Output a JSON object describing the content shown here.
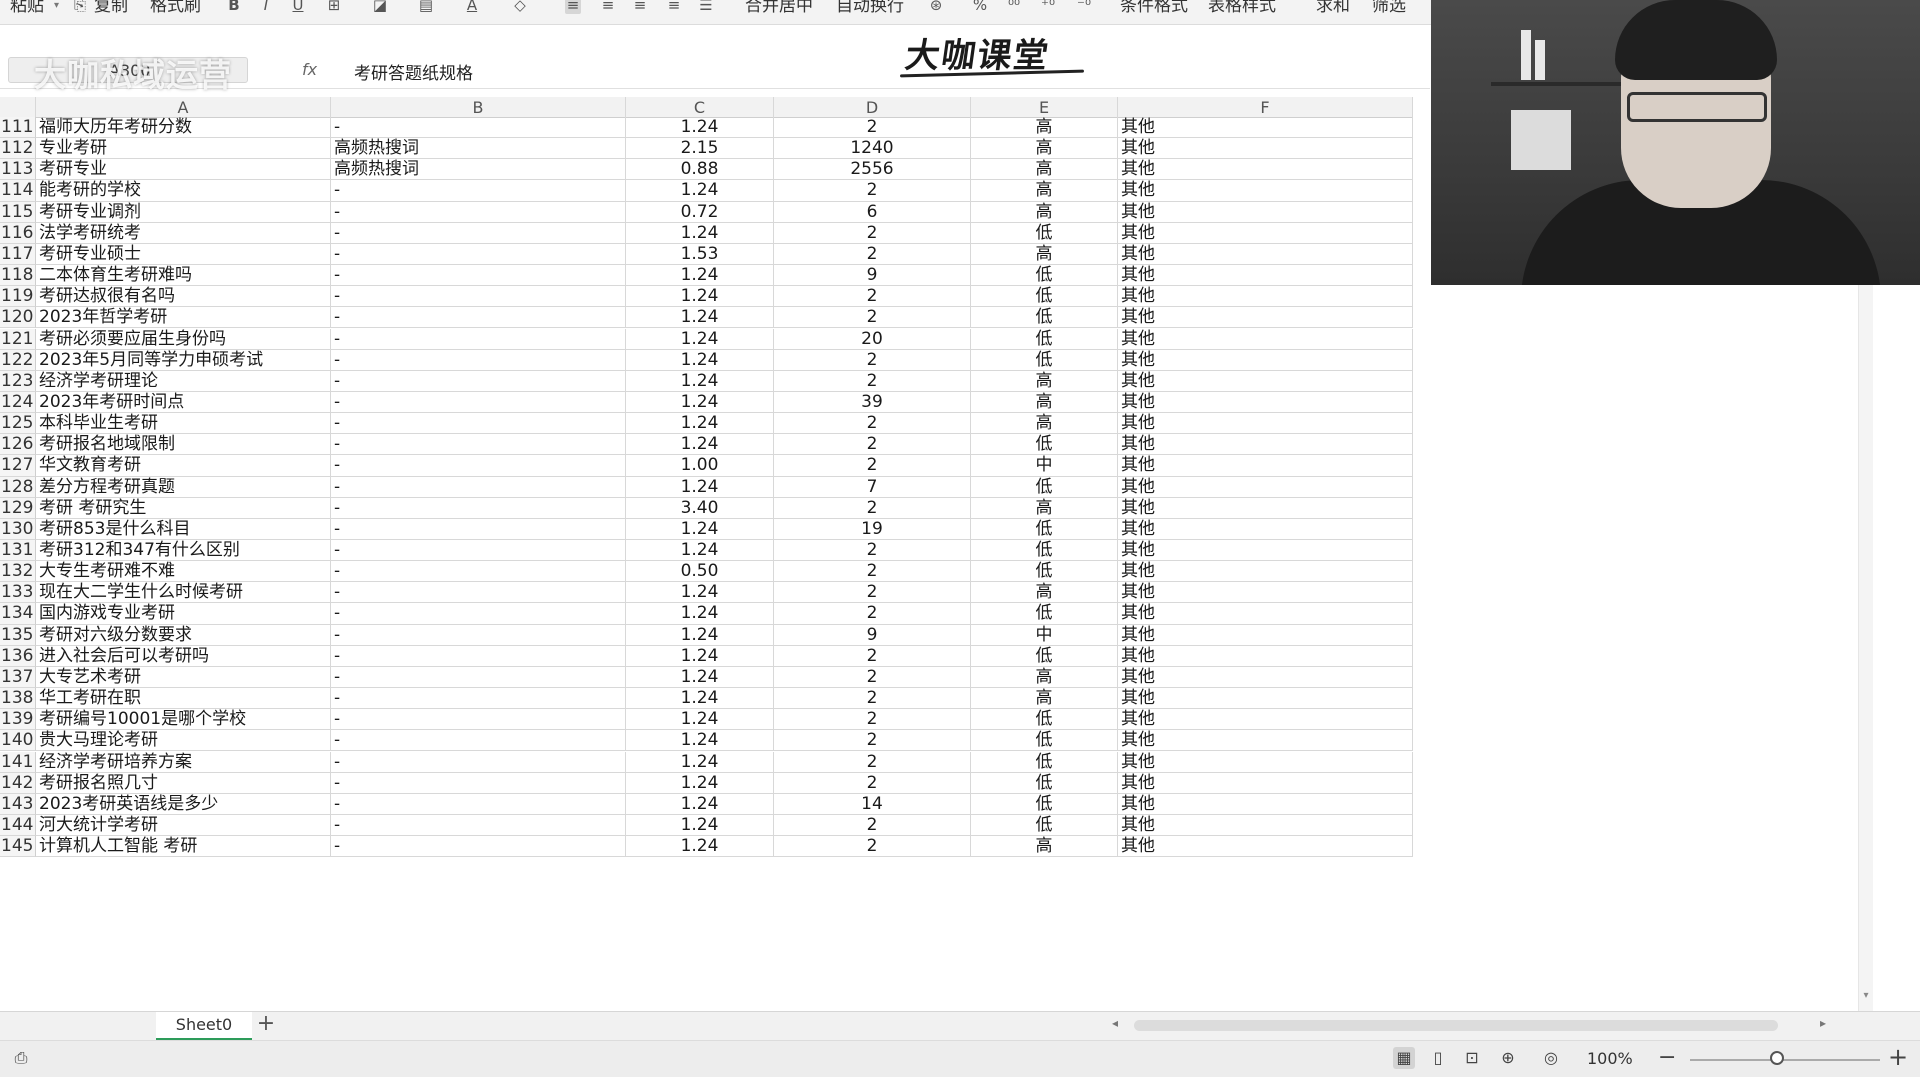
{
  "ribbon": {
    "paste": "粘贴",
    "copy": "复制",
    "format_painter": "格式刷",
    "merge_center": "合并居中",
    "wrap_text": "自动换行",
    "conditional_format": "条件格式",
    "table_style": "表格样式",
    "sum": "求和",
    "filter": "筛选",
    "bold": "B",
    "italic": "I",
    "underline": "U",
    "font_color": "A",
    "percent": "%"
  },
  "formula_bar": {
    "name_box": "A300",
    "fx": "fx",
    "value": "考研答题纸规格"
  },
  "watermark": "大咖私域运营",
  "brand_logo": "大咖课堂",
  "columns": [
    "A",
    "B",
    "C",
    "D",
    "E",
    "F"
  ],
  "rows": [
    {
      "n": "111",
      "a": "福师大历年考研分数",
      "b": "-",
      "c": "1.24",
      "d": "2",
      "e": "高",
      "f": "其他"
    },
    {
      "n": "112",
      "a": "专业考研",
      "b": "高频热搜词",
      "c": "2.15",
      "d": "1240",
      "e": "高",
      "f": "其他"
    },
    {
      "n": "113",
      "a": "考研专业",
      "b": "高频热搜词",
      "c": "0.88",
      "d": "2556",
      "e": "高",
      "f": "其他"
    },
    {
      "n": "114",
      "a": "能考研的学校",
      "b": "-",
      "c": "1.24",
      "d": "2",
      "e": "高",
      "f": "其他"
    },
    {
      "n": "115",
      "a": "考研专业调剂",
      "b": "-",
      "c": "0.72",
      "d": "6",
      "e": "高",
      "f": "其他"
    },
    {
      "n": "116",
      "a": "法学考研统考",
      "b": "-",
      "c": "1.24",
      "d": "2",
      "e": "低",
      "f": "其他"
    },
    {
      "n": "117",
      "a": "考研专业硕士",
      "b": "-",
      "c": "1.53",
      "d": "2",
      "e": "高",
      "f": "其他"
    },
    {
      "n": "118",
      "a": "二本体育生考研难吗",
      "b": "-",
      "c": "1.24",
      "d": "9",
      "e": "低",
      "f": "其他"
    },
    {
      "n": "119",
      "a": "考研达叔很有名吗",
      "b": "-",
      "c": "1.24",
      "d": "2",
      "e": "低",
      "f": "其他"
    },
    {
      "n": "120",
      "a": "2023年哲学考研",
      "b": "-",
      "c": "1.24",
      "d": "2",
      "e": "低",
      "f": "其他"
    },
    {
      "n": "121",
      "a": "考研必须要应届生身份吗",
      "b": "-",
      "c": "1.24",
      "d": "20",
      "e": "低",
      "f": "其他"
    },
    {
      "n": "122",
      "a": "2023年5月同等学力申硕考试",
      "b": "-",
      "c": "1.24",
      "d": "2",
      "e": "低",
      "f": "其他"
    },
    {
      "n": "123",
      "a": "经济学考研理论",
      "b": "-",
      "c": "1.24",
      "d": "2",
      "e": "高",
      "f": "其他"
    },
    {
      "n": "124",
      "a": "2023年考研时间点",
      "b": "-",
      "c": "1.24",
      "d": "39",
      "e": "高",
      "f": "其他"
    },
    {
      "n": "125",
      "a": "本科毕业生考研",
      "b": "-",
      "c": "1.24",
      "d": "2",
      "e": "高",
      "f": "其他"
    },
    {
      "n": "126",
      "a": "考研报名地域限制",
      "b": "-",
      "c": "1.24",
      "d": "2",
      "e": "低",
      "f": "其他"
    },
    {
      "n": "127",
      "a": "华文教育考研",
      "b": "-",
      "c": "1.00",
      "d": "2",
      "e": "中",
      "f": "其他"
    },
    {
      "n": "128",
      "a": "差分方程考研真题",
      "b": "-",
      "c": "1.24",
      "d": "7",
      "e": "低",
      "f": "其他"
    },
    {
      "n": "129",
      "a": "考研 考研究生",
      "b": "-",
      "c": "3.40",
      "d": "2",
      "e": "高",
      "f": "其他"
    },
    {
      "n": "130",
      "a": "考研853是什么科目",
      "b": "-",
      "c": "1.24",
      "d": "19",
      "e": "低",
      "f": "其他"
    },
    {
      "n": "131",
      "a": "考研312和347有什么区别",
      "b": "-",
      "c": "1.24",
      "d": "2",
      "e": "低",
      "f": "其他"
    },
    {
      "n": "132",
      "a": "大专生考研难不难",
      "b": "-",
      "c": "0.50",
      "d": "2",
      "e": "低",
      "f": "其他"
    },
    {
      "n": "133",
      "a": "现在大二学生什么时候考研",
      "b": "-",
      "c": "1.24",
      "d": "2",
      "e": "高",
      "f": "其他"
    },
    {
      "n": "134",
      "a": "国内游戏专业考研",
      "b": "-",
      "c": "1.24",
      "d": "2",
      "e": "低",
      "f": "其他"
    },
    {
      "n": "135",
      "a": "考研对六级分数要求",
      "b": "-",
      "c": "1.24",
      "d": "9",
      "e": "中",
      "f": "其他"
    },
    {
      "n": "136",
      "a": "进入社会后可以考研吗",
      "b": "-",
      "c": "1.24",
      "d": "2",
      "e": "低",
      "f": "其他"
    },
    {
      "n": "137",
      "a": "大专艺术考研",
      "b": "-",
      "c": "1.24",
      "d": "2",
      "e": "高",
      "f": "其他"
    },
    {
      "n": "138",
      "a": "华工考研在职",
      "b": "-",
      "c": "1.24",
      "d": "2",
      "e": "高",
      "f": "其他"
    },
    {
      "n": "139",
      "a": "考研编号10001是哪个学校",
      "b": "-",
      "c": "1.24",
      "d": "2",
      "e": "低",
      "f": "其他"
    },
    {
      "n": "140",
      "a": "贵大马理论考研",
      "b": "-",
      "c": "1.24",
      "d": "2",
      "e": "低",
      "f": "其他"
    },
    {
      "n": "141",
      "a": "经济学考研培养方案",
      "b": "-",
      "c": "1.24",
      "d": "2",
      "e": "低",
      "f": "其他"
    },
    {
      "n": "142",
      "a": "考研报名照几寸",
      "b": "-",
      "c": "1.24",
      "d": "2",
      "e": "低",
      "f": "其他"
    },
    {
      "n": "143",
      "a": "2023考研英语线是多少",
      "b": "-",
      "c": "1.24",
      "d": "14",
      "e": "低",
      "f": "其他"
    },
    {
      "n": "144",
      "a": "河大统计学考研",
      "b": "-",
      "c": "1.24",
      "d": "2",
      "e": "低",
      "f": "其他"
    },
    {
      "n": "145",
      "a": "计算机人工智能 考研",
      "b": "-",
      "c": "1.24",
      "d": "2",
      "e": "高",
      "f": "其他"
    }
  ],
  "sheet_tabs": [
    "Sheet0"
  ],
  "add_sheet": "+",
  "status": {
    "zoom": "100%"
  },
  "colors": {
    "tab_accent": "#2d9c5a",
    "header_bg": "#f2f2f2"
  }
}
